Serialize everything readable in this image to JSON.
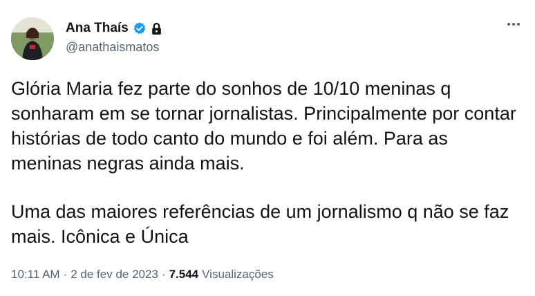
{
  "author": {
    "display_name": "Ana Thaís",
    "handle": "@anathaismatos",
    "verified_icon": "verified-badge-icon",
    "protected_icon": "lock-icon"
  },
  "menu": {
    "icon": "more-horizontal-icon"
  },
  "tweet": {
    "paragraphs": [
      "Glória Maria fez parte do sonhos de 10/10 meninas q sonharam em se tornar jornalistas. Principalmente por contar histórias de todo canto do mundo e foi além. Para as meninas negras ainda mais.",
      "Uma das maiores referências de um jornalismo q não se faz mais. Icônica e Única"
    ]
  },
  "meta": {
    "time": "10:11 AM",
    "separator": "·",
    "date": "2 de fev de 2023",
    "views_count": "7.544",
    "views_label": "Visualizações"
  },
  "colors": {
    "verified": "#1d9bf0",
    "text": "#0f1419",
    "secondary": "#536471"
  }
}
